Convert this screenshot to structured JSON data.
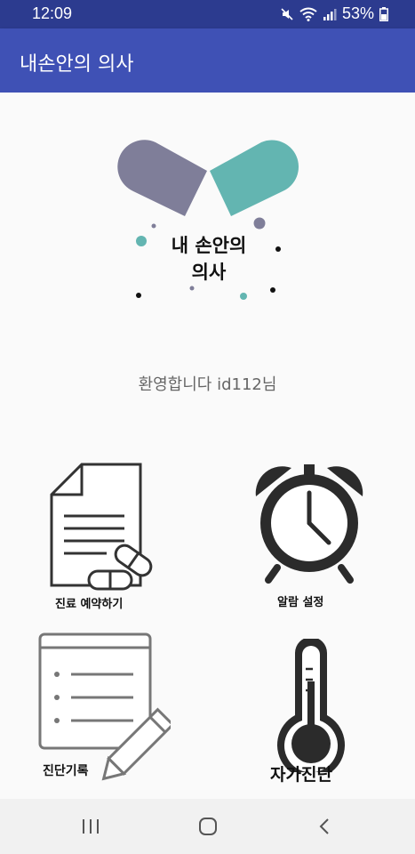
{
  "status_bar": {
    "time": "12:09",
    "battery": "53%",
    "icons": [
      "mute-icon",
      "wifi-icon",
      "signal-icon",
      "battery-icon"
    ]
  },
  "app_bar": {
    "title": "내손안의 의사"
  },
  "logo": {
    "line1": "내 손안의",
    "line2": "의사",
    "colors": {
      "gray_capsule": "#7f7e99",
      "teal_capsule": "#63b5b1"
    }
  },
  "welcome": {
    "text": "환영합니다 id112님"
  },
  "menu": {
    "reservation": {
      "label": "진료 예약하기",
      "icon": "document-pills-icon"
    },
    "alarm": {
      "label": "알람 설정",
      "icon": "alarm-clock-icon"
    },
    "records": {
      "label": "진단기록",
      "icon": "notepad-pencil-icon"
    },
    "self_check": {
      "label": "자가진단",
      "icon": "thermometer-icon"
    }
  },
  "nav_bar": {
    "buttons": [
      "recent-apps-icon",
      "home-icon",
      "back-icon"
    ]
  },
  "colors": {
    "status_bar": "#2c3b8f",
    "app_bar": "#3f51b5",
    "background": "#fafafa",
    "nav_bar": "#f1f1f1"
  }
}
